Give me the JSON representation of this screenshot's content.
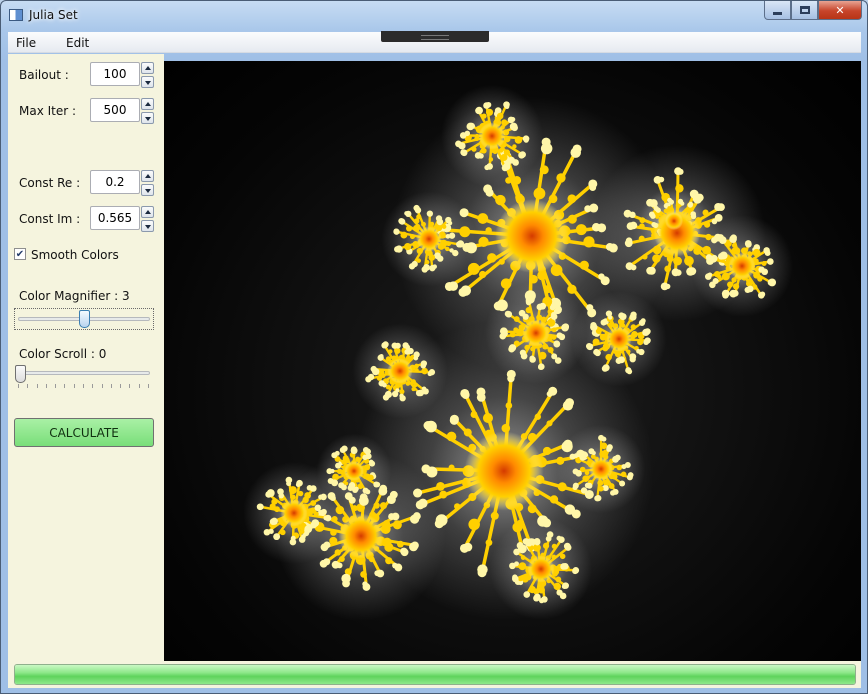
{
  "window": {
    "title": "Julia Set"
  },
  "menu": [
    {
      "label": "File"
    },
    {
      "label": "Edit"
    }
  ],
  "controls": {
    "bailout": {
      "label": "Bailout :",
      "value": "100"
    },
    "max_iter": {
      "label": "Max Iter :",
      "value": "500"
    },
    "const_re": {
      "label": "Const Re :",
      "value": "0.2"
    },
    "const_im": {
      "label": "Const Im :",
      "value": "0.565"
    },
    "smooth_colors": {
      "label": "Smooth Colors",
      "checked": true
    },
    "color_magnifier": {
      "label": "Color Magnifier : 3",
      "value": 3,
      "level": 0.5
    },
    "color_scroll": {
      "label": "Color Scroll : 0",
      "value": 0,
      "level": 0
    },
    "calculate": {
      "label": "CALCULATE"
    }
  },
  "progress": {
    "level": 1.0
  },
  "colors": {
    "fractal_core": "#d43a00",
    "fractal_mid": "#ffd000",
    "fractal_edge": "#fff6a8",
    "glow": "#ffffff",
    "background": "#000000"
  }
}
